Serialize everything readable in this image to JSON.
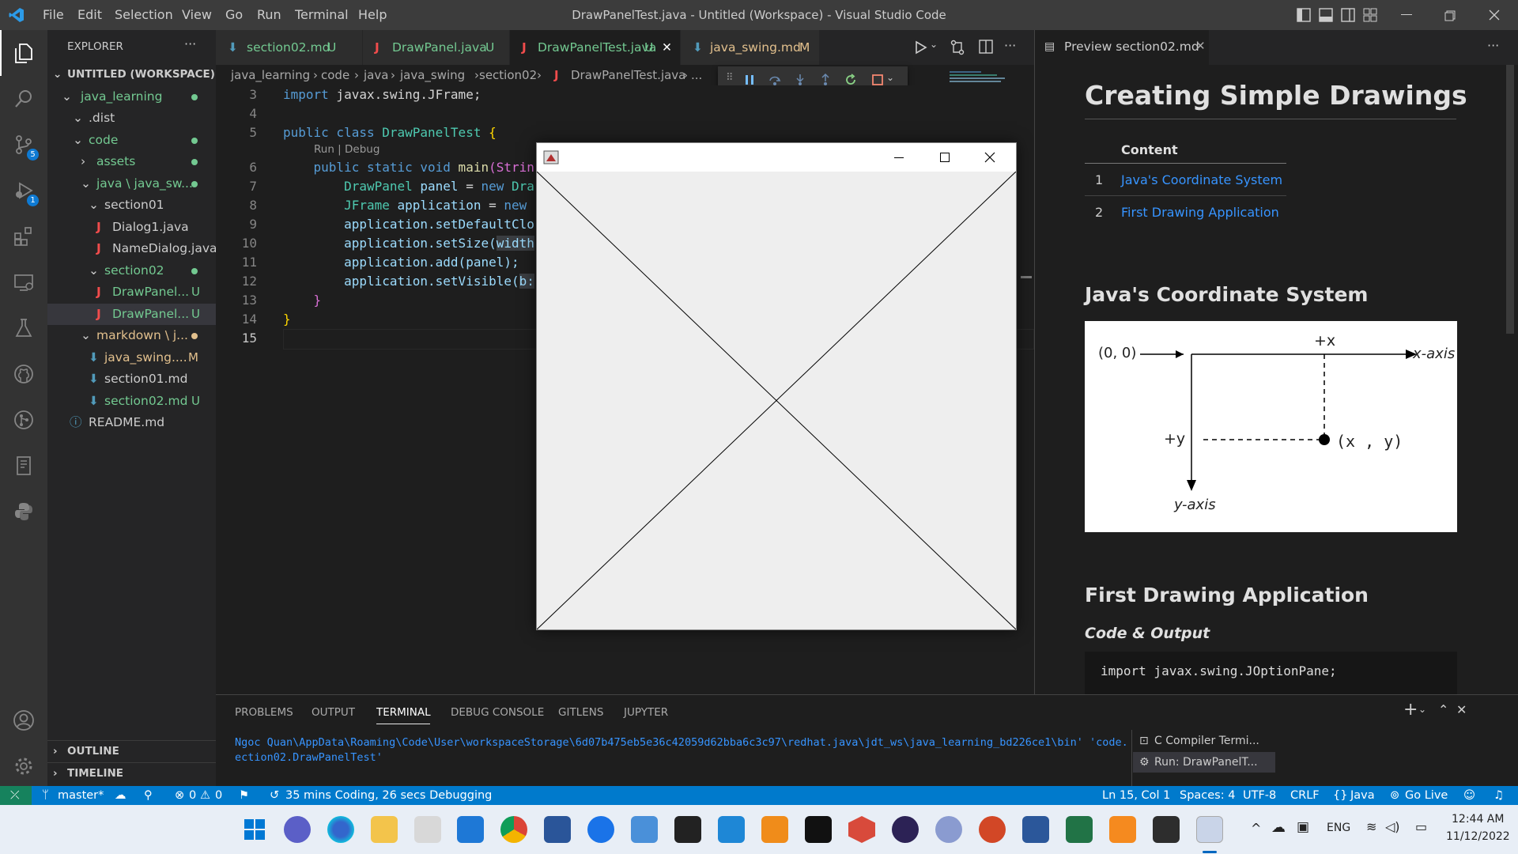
{
  "window": {
    "title": "DrawPanelTest.java - Untitled (Workspace) - Visual Studio Code",
    "menu": [
      "File",
      "Edit",
      "Selection",
      "View",
      "Go",
      "Run",
      "Terminal",
      "Help"
    ]
  },
  "activity": {
    "scm_badge": "5",
    "debug_badge": "1"
  },
  "explorer": {
    "header": "EXPLORER",
    "more": "···",
    "workspace": "UNTITLED (WORKSPACE)",
    "items": [
      {
        "label": "java_learning"
      },
      {
        "label": ".dist"
      },
      {
        "label": "code"
      },
      {
        "label": "assets"
      },
      {
        "label": "java \\ java_sw..."
      },
      {
        "label": "section01"
      },
      {
        "label": "Dialog1.java"
      },
      {
        "label": "NameDialog.java"
      },
      {
        "label": "section02"
      },
      {
        "label": "DrawPanel...",
        "status": "U"
      },
      {
        "label": "DrawPanel...",
        "status": "U"
      },
      {
        "label": "markdown \\ j..."
      },
      {
        "label": "java_swing....",
        "status": "M"
      },
      {
        "label": "section01.md"
      },
      {
        "label": "section02.md",
        "status": "U"
      },
      {
        "label": "README.md"
      }
    ],
    "outline": "OUTLINE",
    "timeline": "TIMELINE"
  },
  "tabs": [
    {
      "label": "section02.md",
      "status": "U"
    },
    {
      "label": "DrawPanel.java",
      "status": "U"
    },
    {
      "label": "DrawPanelTest.java",
      "status": "U"
    },
    {
      "label": "java_swing.md",
      "status": "M"
    }
  ],
  "breadcrumb": [
    "java_learning",
    "code",
    "java",
    "java_swing",
    "section02",
    "DrawPanelTest.java",
    "..."
  ],
  "code": {
    "line_numbers": [
      "3",
      "4",
      "5",
      "",
      "6",
      "7",
      "8",
      "9",
      "10",
      "11",
      "12",
      "13",
      "14",
      "15"
    ],
    "codelens": "Run | Debug",
    "lines": {
      "l3a": "import",
      "l3b": " javax.swing.JFrame;",
      "l5a": "public class",
      "l5b": " DrawPanelTest ",
      "l5c": "{",
      "l6a": "    public static void",
      "l6b": " main",
      "l6c": "(Strin",
      "l7a": "        DrawPanel",
      "l7b": " panel",
      "l7c": " = ",
      "l7d": "new",
      "l7e": " Dra",
      "l8a": "        JFrame",
      "l8b": " application",
      "l8c": " = ",
      "l8d": "new",
      "l9": "        application.setDefaultClo",
      "l10a": "        application.setSize(",
      "l10b": "width",
      "l11": "        application.add(panel);",
      "l12a": "        application.setVisible(",
      "l12b": "b:",
      "l13": "    }",
      "l14": "}"
    }
  },
  "preview": {
    "tab": "Preview section02.md",
    "h1": "Creating Simple Drawings",
    "toc_header": "Content",
    "toc": [
      {
        "num": "1",
        "label": "Java's Coordinate System"
      },
      {
        "num": "2",
        "label": "First Drawing Application"
      }
    ],
    "h2a": "Java's Coordinate System",
    "diagram": {
      "origin": "(0, 0)",
      "plus_x": "+x",
      "x_axis": "x-axis",
      "plus_y": "+y",
      "y_axis": "y-axis",
      "point": "(x , y)"
    },
    "h2b": "First Drawing Application",
    "h3": "Code & Output",
    "code": "import javax.swing.JOptionPane;"
  },
  "panel": {
    "tabs": [
      "PROBLEMS",
      "OUTPUT",
      "TERMINAL",
      "DEBUG CONSOLE",
      "GITLENS",
      "JUPYTER"
    ],
    "active": "TERMINAL",
    "terminal_line1": "Ngoc Quan\\AppData\\Roaming\\Code\\User\\workspaceStorage\\6d07b475eb5e36c42059d62bba6c3c97\\redhat.java\\jdt_ws\\java_learning_bd226ce1\\bin' 'code.java.java_swing.s",
    "terminal_line2": "ection02.DrawPanelTest'",
    "terminals": [
      "C Compiler Termi...",
      "Run: DrawPanelT..."
    ]
  },
  "status": {
    "branch": "master*",
    "errors": "0",
    "warnings": "0",
    "time": "35 mins Coding, 26 secs Debugging",
    "position": "Ln 15, Col 1",
    "spaces": "Spaces: 4",
    "encoding": "UTF-8",
    "eol": "CRLF",
    "language": "Java",
    "golive": "Go Live"
  },
  "taskbar": {
    "lang": "ENG",
    "time": "12:44 AM",
    "date": "11/12/2022"
  },
  "colors": {
    "accent": "#007acc",
    "link": "#3794ff",
    "untracked": "#73c991",
    "modified": "#e2c08d"
  }
}
